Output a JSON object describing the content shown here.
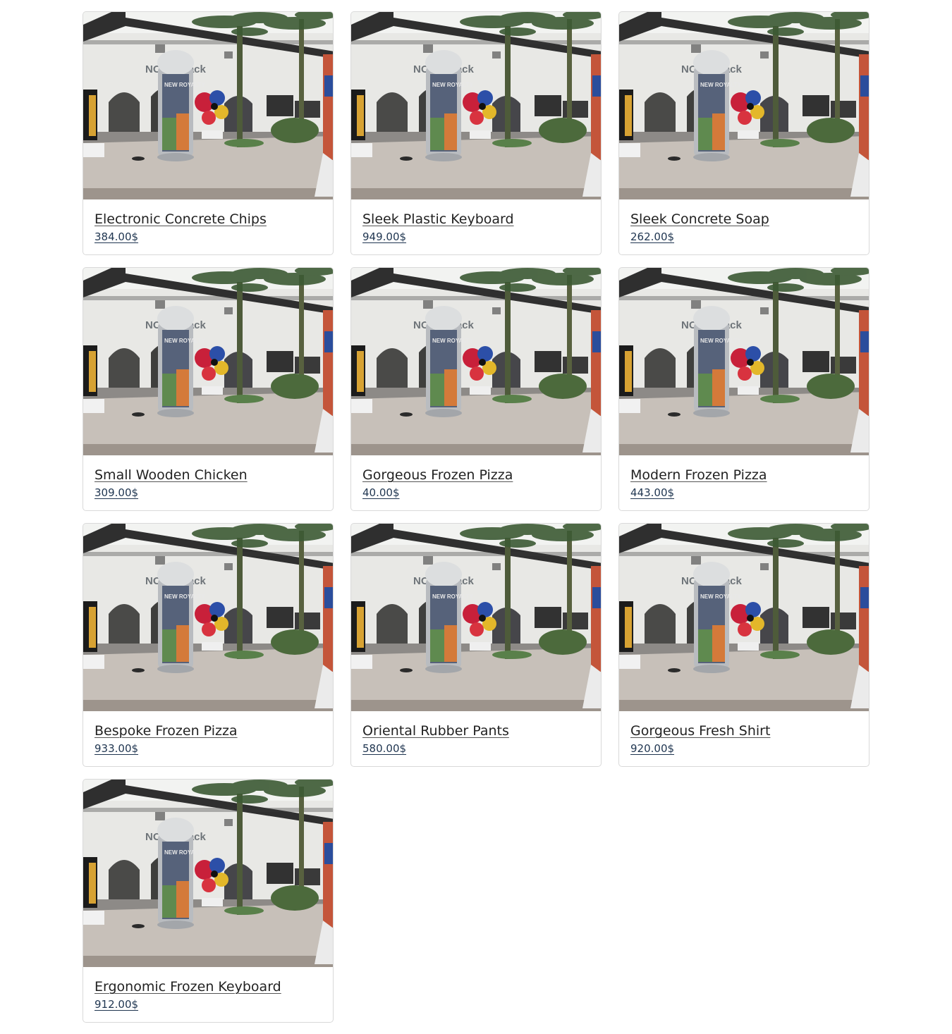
{
  "products": [
    {
      "name": "Electronic Concrete Chips",
      "price": "384.00$"
    },
    {
      "name": "Sleek Plastic Keyboard",
      "price": "949.00$"
    },
    {
      "name": "Sleek Concrete Soap",
      "price": "262.00$"
    },
    {
      "name": "Small Wooden Chicken",
      "price": "309.00$"
    },
    {
      "name": "Gorgeous Frozen Pizza",
      "price": "40.00$"
    },
    {
      "name": "Modern Frozen Pizza",
      "price": "443.00$"
    },
    {
      "name": "Bespoke Frozen Pizza",
      "price": "933.00$"
    },
    {
      "name": "Oriental Rubber Pants",
      "price": "580.00$"
    },
    {
      "name": "Gorgeous Fresh Shirt",
      "price": "920.00$"
    },
    {
      "name": "Ergonomic Frozen Keyboard",
      "price": "912.00$"
    }
  ],
  "photo": {
    "storefront_sign": "NO     OM rack",
    "kiosk_text": "NEW ROYALTY",
    "colors": {
      "sky": "#f2f3f1",
      "building": "#e9e9e6",
      "ground": "#c9c2bb",
      "trim": "#2d2d2d",
      "palm": "#3c5a34",
      "kiosk": "#b9bcc0"
    }
  }
}
